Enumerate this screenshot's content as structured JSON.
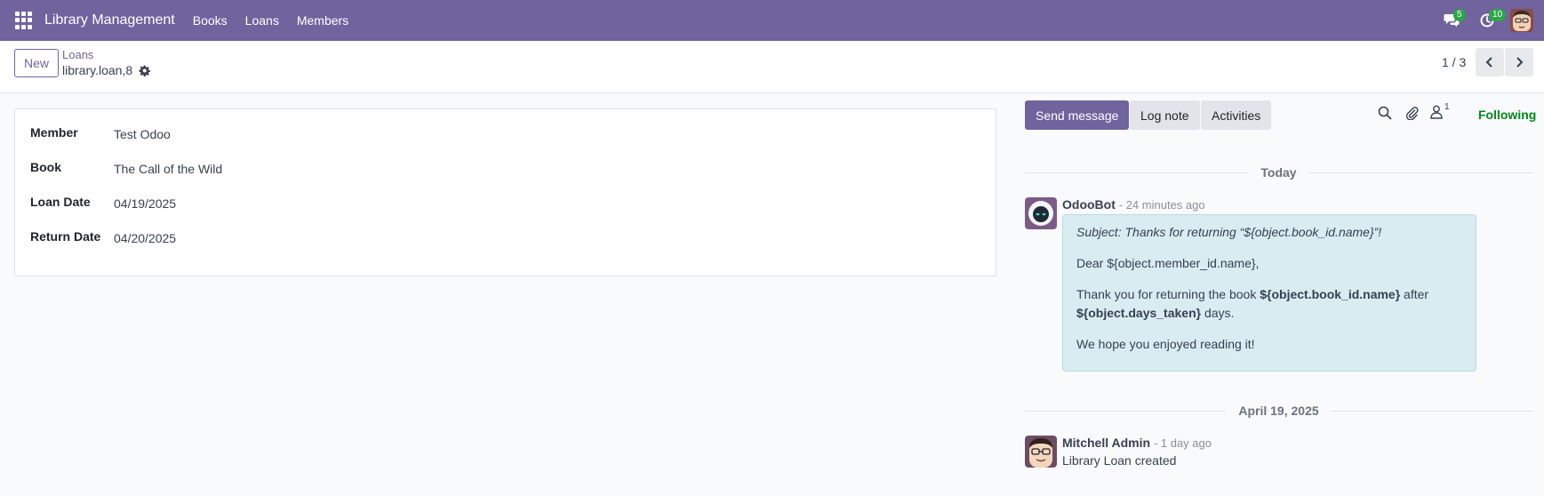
{
  "navbar": {
    "app_title": "Library Management",
    "menu": [
      "Books",
      "Loans",
      "Members"
    ],
    "messages_count": "5",
    "activities_count": "10"
  },
  "control_panel": {
    "new_label": "New",
    "breadcrumb": "Loans",
    "record_name": "library.loan,8",
    "pager": "1 / 3"
  },
  "form": {
    "fields": [
      {
        "label": "Member",
        "value": "Test Odoo"
      },
      {
        "label": "Book",
        "value": "The Call of the Wild"
      },
      {
        "label": "Loan Date",
        "value": "04/19/2025"
      },
      {
        "label": "Return Date",
        "value": "04/20/2025"
      }
    ]
  },
  "chatter": {
    "send_message": "Send message",
    "log_note": "Log note",
    "activities": "Activities",
    "followers_count": "1",
    "following": "Following",
    "separators": [
      "Today",
      "April 19, 2025"
    ],
    "messages": [
      {
        "author": "OdooBot",
        "time": "- 24 minutes ago",
        "subject": "Subject: Thanks for returning “${object.book_id.name}”!",
        "greeting": "Dear ${object.member_id.name},",
        "body_pre": "Thank you for returning the book ",
        "body_book": "${object.book_id.name}",
        "body_mid": " after",
        "body_days": "${object.days_taken}",
        "body_post": " days.",
        "closing": "We hope you enjoyed reading it!"
      },
      {
        "author": "Mitchell Admin",
        "time": "- 1 day ago",
        "body": "Library Loan created"
      }
    ]
  },
  "colors": {
    "brand": "#71639e",
    "following": "#008818",
    "badge": "#28a745",
    "message_bubble": "#d9ecf1"
  },
  "icons": [
    "apps-icon",
    "chat-icon",
    "clock-icon",
    "gear-icon",
    "chevron-left-icon",
    "chevron-right-icon",
    "search-icon",
    "paperclip-icon",
    "user-icon"
  ]
}
